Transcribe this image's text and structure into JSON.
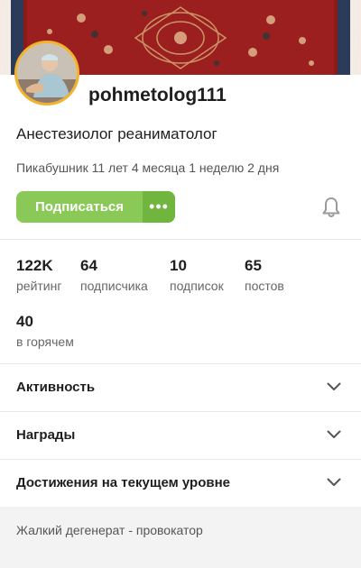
{
  "profile": {
    "username": "pohmetolog111",
    "bio": "Анестезиолог реаниматолог",
    "member_since": "Пикабушник 11 лет 4 месяца 1 неделю 2 дня"
  },
  "actions": {
    "subscribe_label": "Подписаться",
    "more_label": "•••"
  },
  "stats": [
    {
      "value": "122K",
      "label": "рейтинг"
    },
    {
      "value": "64",
      "label": "подписчика"
    },
    {
      "value": "10",
      "label": "подписок"
    },
    {
      "value": "65",
      "label": "постов"
    },
    {
      "value": "40",
      "label": "в горячем"
    }
  ],
  "sections": [
    {
      "title": "Активность"
    },
    {
      "title": "Награды"
    },
    {
      "title": "Достижения на текущем уровне"
    }
  ],
  "footer": {
    "note": "Жалкий дегенерат - провокатор"
  },
  "colors": {
    "accent_green": "#8ac858",
    "accent_green_dark": "#6fb53e",
    "avatar_ring": "#f2b22a",
    "cover_red": "#8b1a1a"
  },
  "icons": [
    "bell-icon",
    "chevron-down-icon",
    "more-dots-icon"
  ]
}
